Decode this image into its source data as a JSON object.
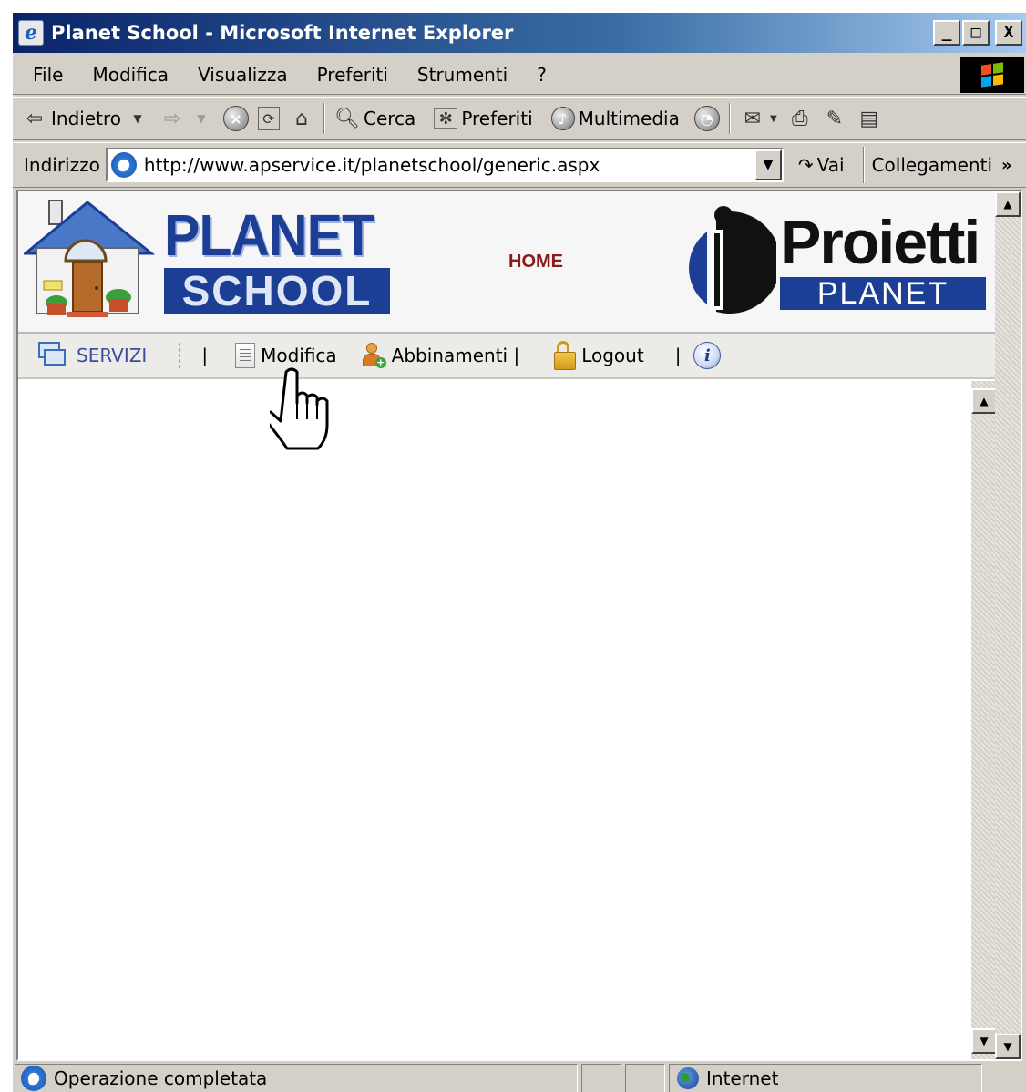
{
  "window": {
    "title": "Planet School - Microsoft Internet Explorer",
    "controls": {
      "minimize": "_",
      "maximize": "□",
      "close": "X"
    }
  },
  "menubar": {
    "items": [
      {
        "label": "File"
      },
      {
        "label": "Modifica"
      },
      {
        "label": "Visualizza"
      },
      {
        "label": "Preferiti"
      },
      {
        "label": "Strumenti"
      },
      {
        "label": "?"
      }
    ]
  },
  "toolbar": {
    "back": "Indietro",
    "search": "Cerca",
    "favorites": "Preferiti",
    "media": "Multimedia"
  },
  "addressbar": {
    "label": "Indirizzo",
    "url": "http://www.apservice.it/planetschool/generic.aspx",
    "go": "Vai",
    "links": "Collegamenti",
    "more": "»"
  },
  "page": {
    "logo_planet": "PLANET",
    "logo_school": "SCHOOL",
    "home": "HOME",
    "logo_proietti": "Proietti",
    "logo_proietti_planet": "PLANET",
    "nav": {
      "servizi": "SERVIZI",
      "sep1": "|",
      "modifica": "Modifica",
      "abbinamenti": "Abbinamenti |",
      "logout": "Logout",
      "sep2": "|"
    }
  },
  "statusbar": {
    "status": "Operazione completata",
    "zone": "Internet"
  },
  "icons": {
    "ie": "e",
    "info": "i"
  }
}
